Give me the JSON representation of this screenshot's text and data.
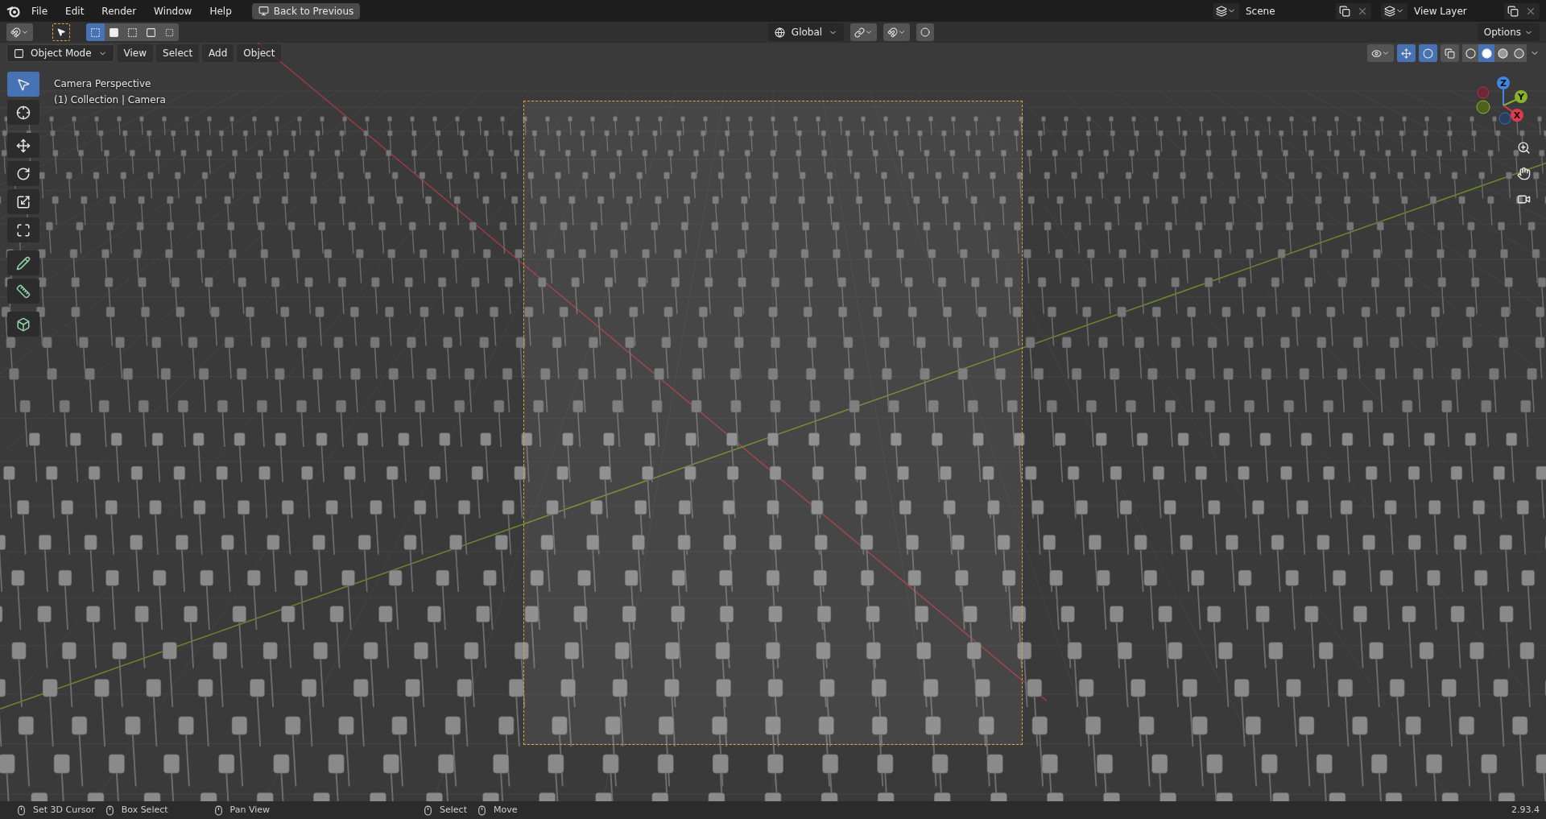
{
  "menu_bar": {
    "menus": [
      "File",
      "Edit",
      "Render",
      "Window",
      "Help"
    ],
    "back_button": "Back to Previous",
    "scene": "Scene",
    "view_layer": "View Layer"
  },
  "tool_header": {
    "select_modes": [
      {
        "kind": "new",
        "selected": true
      },
      {
        "kind": "extend",
        "selected": false
      },
      {
        "kind": "subtract",
        "selected": false
      },
      {
        "kind": "invert",
        "selected": false
      },
      {
        "kind": "intersect",
        "selected": false
      }
    ],
    "orientation": "Global",
    "options": "Options"
  },
  "viewport_header": {
    "mode": "Object Mode",
    "menus": [
      "View",
      "Select",
      "Add",
      "Object"
    ],
    "shading": [
      {
        "kind": "wireframe",
        "selected": false
      },
      {
        "kind": "solid",
        "selected": true
      },
      {
        "kind": "material",
        "selected": false
      },
      {
        "kind": "rendered",
        "selected": false
      }
    ]
  },
  "viewport": {
    "view_name": "Camera Perspective",
    "collection": "(1) Collection | Camera"
  },
  "toolbar": [
    {
      "kind": "select",
      "selected": true
    },
    {
      "kind": "cursor",
      "selected": false
    },
    {
      "kind": "move",
      "selected": false
    },
    {
      "kind": "rotate",
      "selected": false
    },
    {
      "kind": "scale",
      "selected": false
    },
    {
      "kind": "transform",
      "selected": false
    },
    {
      "kind": "annotate",
      "selected": false
    },
    {
      "kind": "measure",
      "selected": false
    },
    {
      "kind": "add-cube",
      "selected": false
    }
  ],
  "gizmo": {
    "z": "Z",
    "y": "Y",
    "x": "X"
  },
  "status_bar": {
    "hints": [
      "Set 3D Cursor",
      "Box Select",
      "Pan View",
      "Select",
      "Move"
    ],
    "version": "2.93.4"
  }
}
